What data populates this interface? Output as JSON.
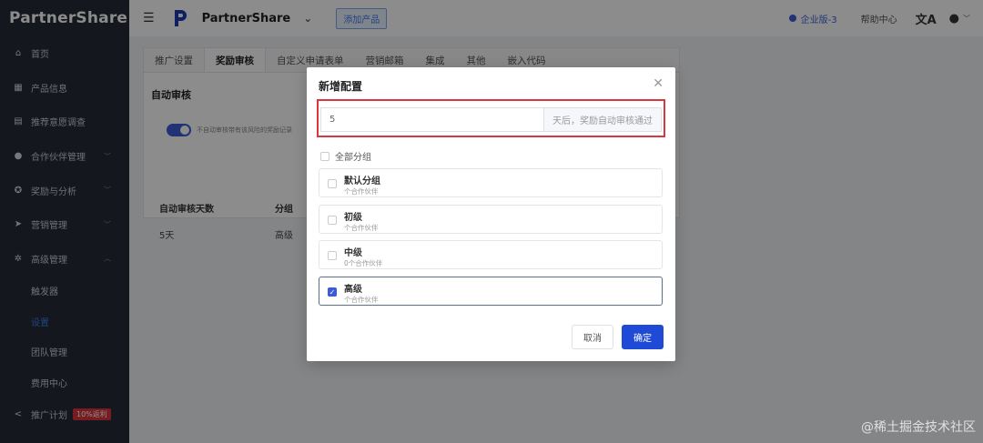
{
  "brand": {
    "logo_text": "PartnerShare"
  },
  "sidebar": {
    "items": [
      {
        "label": "首页",
        "icon": "home-icon"
      },
      {
        "label": "产品信息",
        "icon": "grid-icon"
      },
      {
        "label": "推荐意愿调查",
        "icon": "message-icon"
      },
      {
        "label": "合作伙伴管理",
        "icon": "user-icon"
      },
      {
        "label": "奖励与分析",
        "icon": "target-icon"
      },
      {
        "label": "营销管理",
        "icon": "send-icon"
      },
      {
        "label": "高级管理",
        "icon": "gear-icon"
      }
    ],
    "sub_items": [
      {
        "label": "触发器"
      },
      {
        "label": "设置"
      },
      {
        "label": "团队管理"
      },
      {
        "label": "费用中心"
      }
    ],
    "bottom_item": {
      "label": "推广计划",
      "badge": "10%返利",
      "icon": "share-icon"
    }
  },
  "header": {
    "app_name": "PartnerShare",
    "add_product": "添加产品",
    "edition": "企业版-3",
    "help": "帮助中心"
  },
  "tabs": [
    {
      "label": "推广设置"
    },
    {
      "label": "奖励审核"
    },
    {
      "label": "自定义申请表单"
    },
    {
      "label": "营销邮箱"
    },
    {
      "label": "集成"
    },
    {
      "label": "其他"
    },
    {
      "label": "嵌入代码"
    }
  ],
  "panel": {
    "title": "自动审核",
    "toggle_text": "不自动审核带有该风险的奖励记录",
    "col_days": "自动审核天数",
    "col_group": "分组",
    "row_days": "5天",
    "row_group": "高级"
  },
  "modal": {
    "title": "新增配置",
    "days_value": "5",
    "days_suffix": "天后，奖励自动审核通过",
    "all_groups": "全部分组",
    "groups": [
      {
        "name": "默认分组",
        "count": "个合作伙伴",
        "checked": false
      },
      {
        "name": "初级",
        "count": "个合作伙伴",
        "checked": false
      },
      {
        "name": "中级",
        "count": "0个合作伙伴",
        "checked": false
      },
      {
        "name": "高级",
        "count": "个合作伙伴",
        "checked": true
      }
    ],
    "cancel": "取消",
    "ok": "确定"
  },
  "watermark": "@稀土掘金技术社区",
  "colors": {
    "primary": "#1f4ad6",
    "sidebar_bg": "#262a35",
    "highlight": "#d9363e"
  }
}
